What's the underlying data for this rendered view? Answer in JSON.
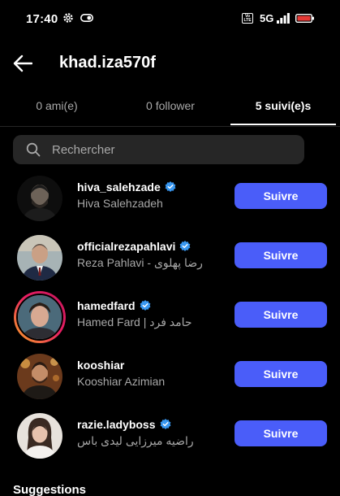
{
  "status_bar": {
    "time": "17:40",
    "volte": "Vo LTE",
    "network": "5G",
    "gear_icon": "gear-icon",
    "toggle_icon": "toggle-icon",
    "signal_icon": "signal-icon",
    "battery_icon": "battery-low-icon",
    "battery_color": "#e53935"
  },
  "header": {
    "back_icon": "arrow-left-icon",
    "title": "khad.iza570f"
  },
  "tabs": [
    {
      "label": "0 ami(e)",
      "active": false
    },
    {
      "label": "0 follower",
      "active": false
    },
    {
      "label": "5 suivi(e)s",
      "active": true
    }
  ],
  "search": {
    "icon": "search-icon",
    "placeholder": "Rechercher",
    "value": ""
  },
  "following": [
    {
      "username": "hiva_salehzade",
      "full_name": "Hiva Salehzadeh",
      "verified": true,
      "story_ring": false,
      "button": "Suivre"
    },
    {
      "username": "officialrezapahlavi",
      "full_name": "Reza Pahlavi - رضا پهلوی",
      "verified": true,
      "story_ring": false,
      "button": "Suivre"
    },
    {
      "username": "hamedfard",
      "full_name": "Hamed Fard | حامد فرد",
      "verified": true,
      "story_ring": true,
      "button": "Suivre"
    },
    {
      "username": "kooshiar",
      "full_name": "Kooshiar Azimian",
      "verified": false,
      "story_ring": false,
      "button": "Suivre"
    },
    {
      "username": "razie.ladyboss",
      "full_name": "راضیه میرزایی لیدی باس",
      "verified": true,
      "story_ring": false,
      "button": "Suivre"
    }
  ],
  "suggestions_label": "Suggestions",
  "colors": {
    "accent": "#4a5df9",
    "verified": "#3897f0",
    "secondary_text": "#a8a8a8",
    "background": "#000000",
    "search_bg": "#262626"
  }
}
